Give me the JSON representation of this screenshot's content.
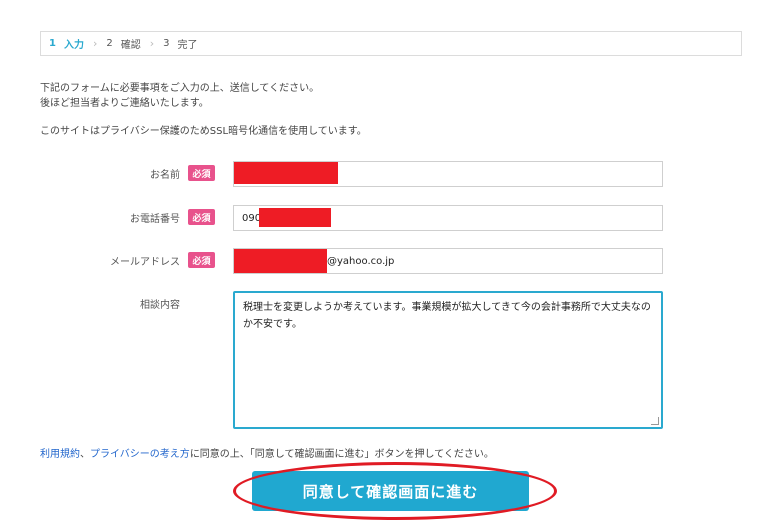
{
  "steps": [
    {
      "num": "1",
      "label": "入力"
    },
    {
      "num": "2",
      "label": "確認"
    },
    {
      "num": "3",
      "label": "完了"
    }
  ],
  "intro": {
    "line1": "下記のフォームに必要事項をご入力の上、送信してください。",
    "line2": "後ほど担当者よりご連絡いたします。",
    "line3": "このサイトはプライバシー保護のためSSL暗号化通信を使用しています。"
  },
  "form": {
    "required_badge": "必須",
    "name": {
      "label": "お名前",
      "value": ""
    },
    "phone": {
      "label": "お電話番号",
      "value": "090"
    },
    "email": {
      "label": "メールアドレス",
      "value": "@yahoo.co.jp"
    },
    "inquiry": {
      "label": "相談内容",
      "value": "税理士を変更しようか考えています。事業規模が拡大してきて今の会計事務所で大丈夫なのか不安です。"
    }
  },
  "agreement": {
    "terms_link": "利用規約",
    "sep": "、",
    "privacy_link": "プライバシーの考え方",
    "text": "に同意の上、「同意して確認画面に進む」ボタンを押してください。"
  },
  "submit_label": "同意して確認画面に進む",
  "colors": {
    "accent": "#20a8d0",
    "required": "#e8528c",
    "redaction": "#ee1c25",
    "highlight": "#e01b24"
  }
}
